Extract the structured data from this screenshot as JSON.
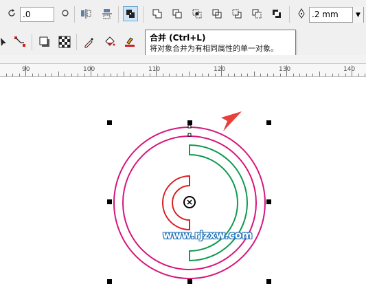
{
  "toolbar": {
    "rotation_value": ".0",
    "outline_width_value": ".2 mm"
  },
  "tooltip": {
    "title": "合并 (Ctrl+L)",
    "description": "将对象合并为有相同属性的单一对象。"
  },
  "ruler": {
    "labels": [
      "90",
      "100",
      "110",
      "120",
      "130",
      "140"
    ]
  },
  "canvas": {
    "watermark": "www.rjzxw.com",
    "colors": {
      "outer_circle": "#d6157a",
      "red_arc": "#dd1c22",
      "green_arc": "#0f9a4e",
      "arrow": "#e8403a"
    }
  },
  "icons": {
    "rotation": "rotate-icon",
    "mirror_h": "mirror-horizontal-icon",
    "mirror_v": "mirror-vertical-icon",
    "combine": "combine-icon",
    "weld": "weld-icon",
    "trim": "trim-icon",
    "intersect": "intersect-icon",
    "simplify": "simplify-icon",
    "front_minus_back": "front-minus-back-icon",
    "back_minus_front": "back-minus-front-icon",
    "boundary": "boundary-icon",
    "outline_pen": "outline-pen-icon"
  }
}
